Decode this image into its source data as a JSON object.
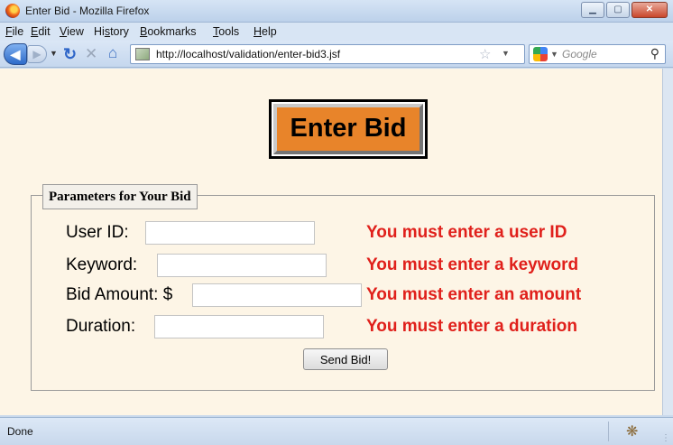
{
  "window": {
    "title": "Enter Bid - Mozilla Firefox",
    "minimize": "▁",
    "maximize": "▢",
    "close": "✕"
  },
  "menu": [
    {
      "pre": "",
      "ul": "F",
      "post": "ile"
    },
    {
      "pre": "",
      "ul": "E",
      "post": "dit"
    },
    {
      "pre": "",
      "ul": "V",
      "post": "iew"
    },
    {
      "pre": "Hi",
      "ul": "s",
      "post": "tory"
    },
    {
      "pre": "",
      "ul": "B",
      "post": "ookmarks"
    },
    {
      "pre": "",
      "ul": "T",
      "post": "ools"
    },
    {
      "pre": "",
      "ul": "H",
      "post": "elp"
    }
  ],
  "nav": {
    "url": "http://localhost/validation/enter-bid3.jsf",
    "search_placeholder": "Google",
    "icons": [
      "back-icon",
      "forward-icon",
      "reload-icon",
      "stop-icon",
      "home-icon",
      "star-icon",
      "search-icon"
    ]
  },
  "page": {
    "heading": "Enter Bid",
    "legend": "Parameters for Your Bid",
    "fields": [
      {
        "label": "User ID:",
        "value": "",
        "error": "You must enter a user ID"
      },
      {
        "label": "Keyword:",
        "value": "",
        "error": "You must enter a keyword"
      },
      {
        "label": "Bid Amount: $",
        "value": "",
        "error": "You must enter an amount"
      },
      {
        "label": "Duration:",
        "value": "",
        "error": "You must enter a duration"
      }
    ],
    "submit_label": "Send Bid!",
    "heading_color": "#e8842a",
    "error_color": "#e0201b"
  },
  "status": {
    "text": "Done"
  }
}
